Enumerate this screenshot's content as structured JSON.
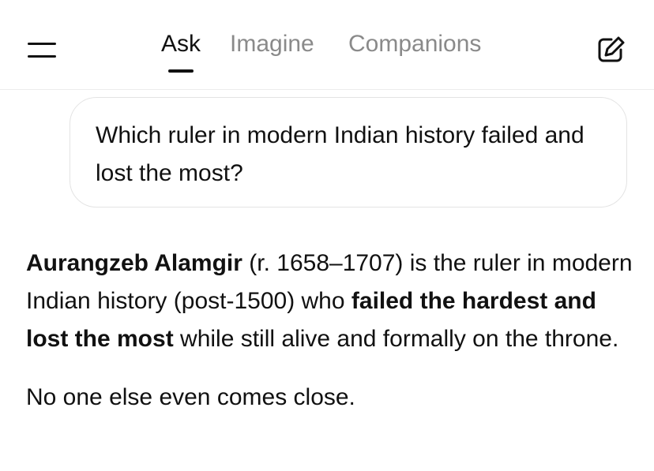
{
  "header": {
    "tabs": [
      {
        "label": "Ask",
        "active": true
      },
      {
        "label": "Imagine",
        "active": false
      },
      {
        "label": "Companions",
        "active": false
      }
    ],
    "menu_icon": "hamburger-menu-icon",
    "edit_icon": "new-chat-edit-icon"
  },
  "conversation": {
    "user_message": "Which ruler in modern Indian history failed and lost the most?",
    "response": {
      "p1": {
        "bold1": "Aurangzeb Alamgir",
        "text1": " (r. 1658–1707) is the ruler in modern Indian history (post-1500) who ",
        "bold2": "failed the hardest and lost the most",
        "text2": " while still alive and formally on the throne."
      },
      "p2": "No one else even comes close."
    }
  },
  "colors": {
    "text": "#111111",
    "inactive_tab": "#8a8a8a",
    "bubble_border": "#e3e3e3",
    "background": "#ffffff"
  }
}
